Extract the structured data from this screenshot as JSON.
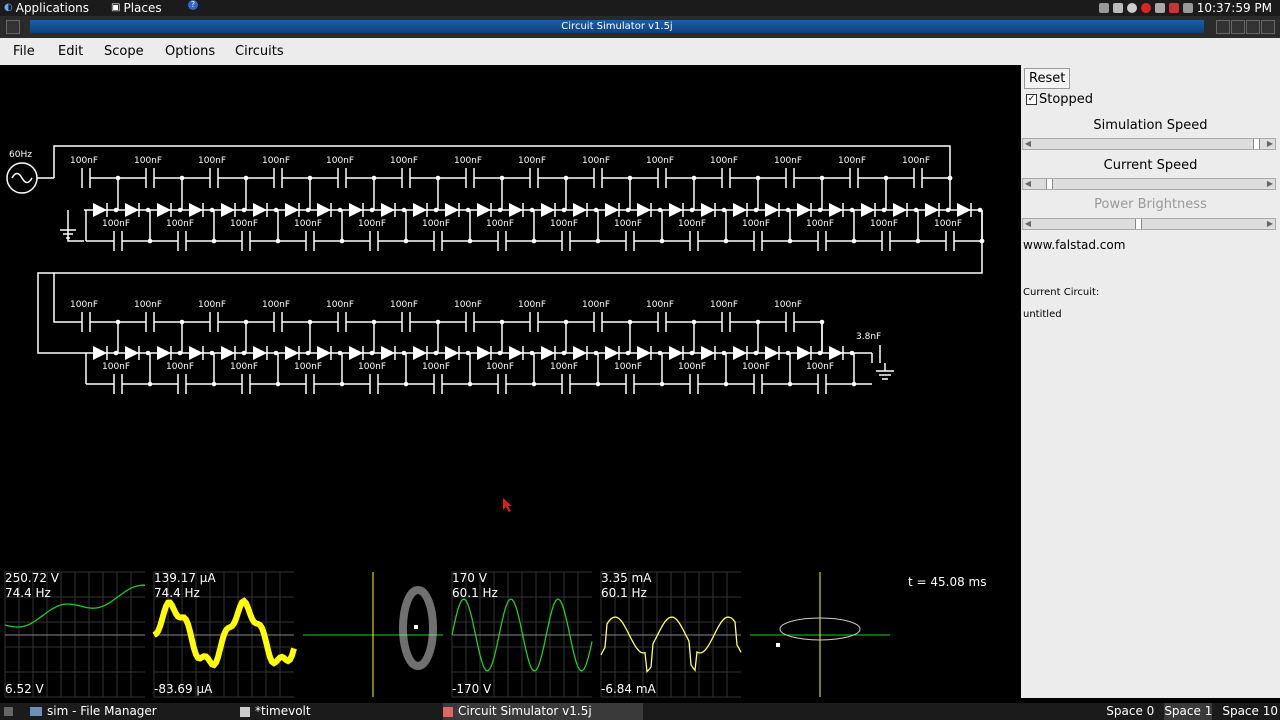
{
  "topbar": {
    "applications": "Applications",
    "places": "Places",
    "clock": "10:37:59 PM"
  },
  "window": {
    "title": "Circuit Simulator v1.5j"
  },
  "menubar": {
    "items": [
      "File",
      "Edit",
      "Scope",
      "Options",
      "Circuits"
    ]
  },
  "sidebar": {
    "reset_label": "Reset",
    "stopped_label": "Stopped",
    "stopped_checked": true,
    "sim_speed_label": "Simulation Speed",
    "sim_speed_value": 0.98,
    "current_speed_label": "Current Speed",
    "current_speed_value": 0.05,
    "power_label": "Power Brightness",
    "power_value": 0.45,
    "website": "www.falstad.com",
    "current_circuit_label": "Current Circuit:",
    "current_circuit_name": "untitled"
  },
  "circuit": {
    "source_label": "60Hz",
    "cap_label": "100nF",
    "end_cap_label": "3.8nF"
  },
  "scopes": [
    {
      "top": "250.72 V",
      "freq": "74.4 Hz",
      "bottom": "6.52 V",
      "color": "#22cc22"
    },
    {
      "top": "139.17 µA",
      "freq": "74.4 Hz",
      "bottom": "-83.69 µA",
      "color": "#ffff00"
    },
    {
      "top": "",
      "freq": "",
      "bottom": "",
      "color": "#cccccc"
    },
    {
      "top": "170 V",
      "freq": "60.1 Hz",
      "bottom": "-170 V",
      "color": "#22cc22"
    },
    {
      "top": "3.35 mA",
      "freq": "60.1 Hz",
      "bottom": "-6.84 mA",
      "color": "#ffff66"
    },
    {
      "top": "",
      "freq": "",
      "bottom": "",
      "color": "#cccccc"
    }
  ],
  "time_label": "t = 45.08 ms",
  "taskbar": {
    "tasks": [
      "sim - File Manager",
      "*timevolt",
      "Circuit Simulator v1.5j"
    ],
    "spaces": [
      "Space 0",
      "Space 1",
      "Space 10"
    ]
  },
  "colors": {
    "accent": "#1a5ea8",
    "wire": "#ffffff",
    "green_trace": "#22cc22",
    "yellow_trace": "#ffff00"
  }
}
